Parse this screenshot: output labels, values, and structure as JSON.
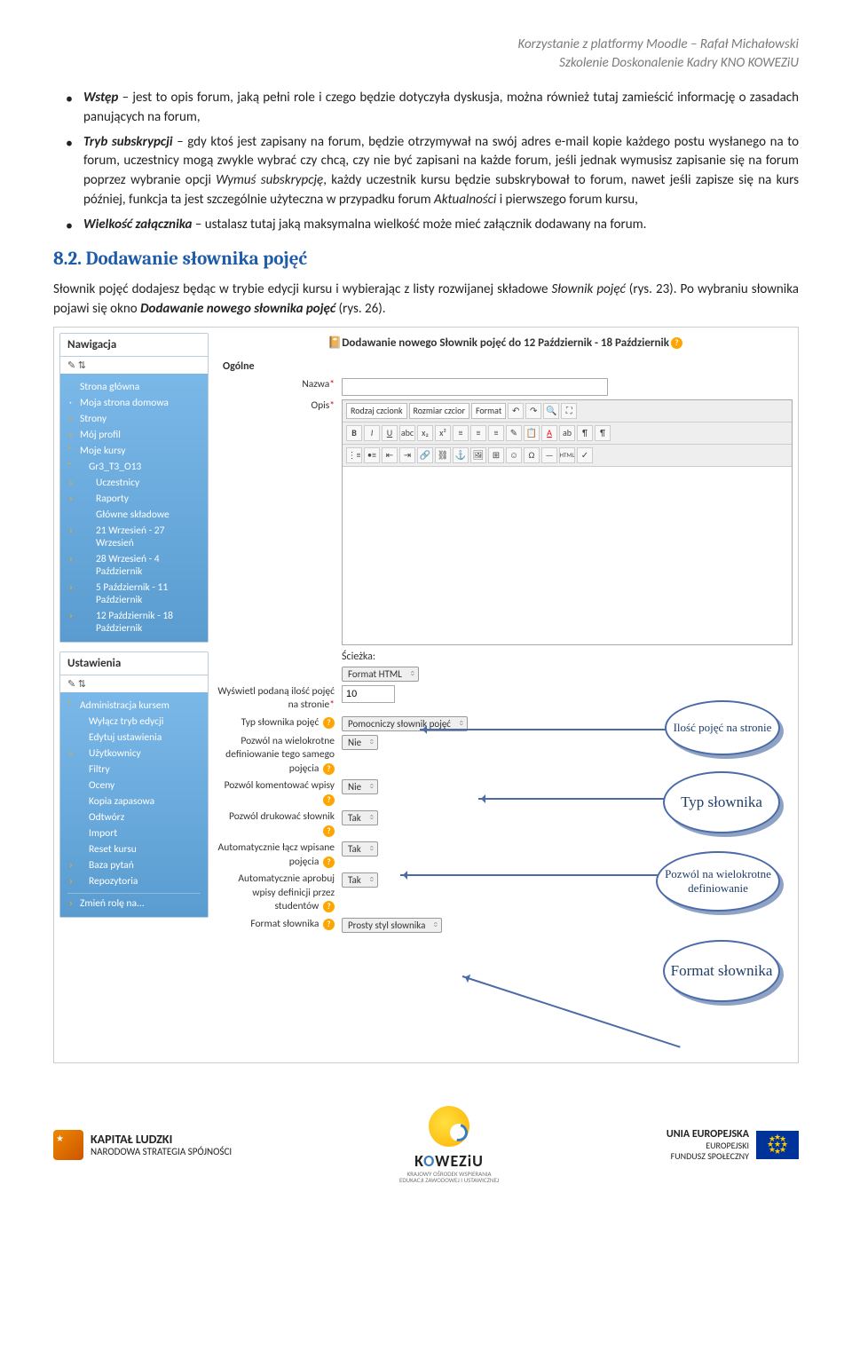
{
  "header": {
    "line1": "Korzystanie z platformy Moodle – Rafał Michałowski",
    "line2": "Szkolenie Doskonalenie Kadry KNO KOWEZiU"
  },
  "bullets": {
    "b1_strong1": "Wstęp",
    "b1_rest": " – jest to opis forum, jaką pełni role i czego będzie dotyczyła dyskusja, można również tutaj zamieścić informację o zasadach panujących na forum,",
    "b2_strong1": "Tryb subskrypcji",
    "b2_mid1": " – gdy ktoś jest zapisany na forum, będzie otrzymywał na swój adres e-mail kopie każdego postu wysłanego na to forum, uczestnicy mogą zwykle wybrać czy chcą, czy nie być zapisani na każde forum, jeśli jednak wymusisz zapisanie się na forum poprzez wybranie opcji ",
    "b2_em": "Wymuś subskrypcję",
    "b2_mid2": ", każdy uczestnik kursu będzie subskrybował to forum, nawet jeśli zapisze się na kurs później, funkcja ta jest szczególnie użyteczna w przypadku forum ",
    "b2_em2": "Aktualności",
    "b2_rest": " i pierwszego forum kursu,",
    "b3_strong1": "Wielkość załącznika",
    "b3_rest": " – ustalasz tutaj jaką maksymalna wielkość może mieć załącznik dodawany na forum."
  },
  "h2": "8.2. Dodawanie słownika pojęć",
  "para": {
    "t1": "Słownik pojęć dodajesz będąc w trybie edycji kursu i wybierając z listy rozwijanej składowe ",
    "em1": "Słownik pojęć",
    "t2": " (rys. 23). Po wybraniu słownika pojawi się okno ",
    "strong1": "Dodawanie nowego słownika pojęć",
    "t3": " (rys. 26)."
  },
  "nav": {
    "title": "Nawigacja",
    "items": [
      "Strona główna",
      "Moja strona domowa",
      "Strony",
      "Mój profil",
      "Moje kursy"
    ],
    "course": "Gr3_T3_O13",
    "courseSub": [
      "Uczestnicy",
      "Raporty",
      "Główne składowe",
      "21 Wrzesień - 27 Wrzesień",
      "28 Wrzesień - 4 Październik",
      "5 Październik - 11 Październik",
      "12 Październik - 18 Październik"
    ]
  },
  "settings": {
    "title": "Ustawienia",
    "admin": "Administracja kursem",
    "items": [
      "Wyłącz tryb edycji",
      "Edytuj ustawienia",
      "Użytkownicy",
      "Filtry",
      "Oceny",
      "Kopia zapasowa",
      "Odtwórz",
      "Import",
      "Reset kursu",
      "Baza pytań",
      "Repozytoria"
    ],
    "role": "Zmień rolę na..."
  },
  "form": {
    "title": "Dodawanie nowego Słownik pojęć do 12 Październik - 18 Październik",
    "section": "Ogólne",
    "labels": {
      "name": "Nazwa",
      "desc": "Opis",
      "path": "Ścieżka:",
      "fhtml": "Format HTML",
      "count": "Wyświetl podaną ilość pojęć na stronie",
      "type": "Typ słownika pojęć",
      "multi": "Pozwól na wielokrotne definiowanie tego samego pojęcia",
      "comment": "Pozwól komentować wpisy",
      "print": "Pozwól drukować słownik",
      "autolink": "Automatycznie łącz wpisane pojęcia",
      "approve": "Automatycznie aprobuj wpisy definicji przez studentów",
      "dformat": "Format słownika"
    },
    "values": {
      "count": "10",
      "type": "Pomocniczy słownik pojęć",
      "nie": "Nie",
      "tak": "Tak",
      "dformat": "Prosty styl słownika"
    },
    "editor": {
      "font": "Rodzaj czcionk",
      "size": "Rozmiar czcior",
      "format": "Format"
    }
  },
  "callouts": {
    "c1": "Ilość pojęć na stronie",
    "c2": "Typ słownika",
    "c3": "Pozwól na wielokrotne definiowanie",
    "c4": "Format słownika"
  },
  "footer": {
    "kl1": "KAPITAŁ LUDZKI",
    "kl2": "NARODOWA STRATEGIA SPÓJNOŚCI",
    "kowezA": "K",
    "kowezB": "O",
    "kowezC": "WEZiU",
    "kowez2": "KRAJOWY OŚRODEK WSPIERANIA",
    "kowez3": "EDUKACJI ZAWODOWEJ I USTAWICZNEJ",
    "eu1": "UNIA EUROPEJSKA",
    "eu2": "EUROPEJSKI",
    "eu3": "FUNDUSZ SPOŁECZNY"
  }
}
